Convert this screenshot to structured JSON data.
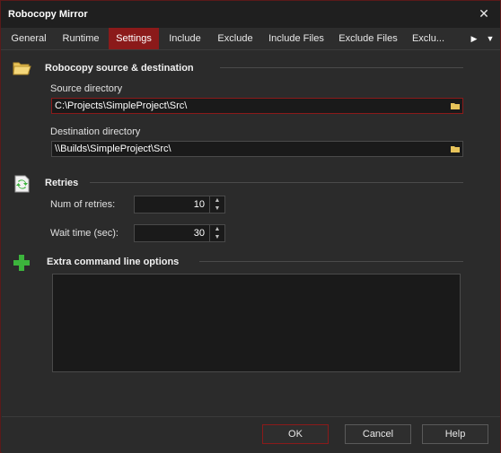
{
  "window": {
    "title": "Robocopy Mirror",
    "close_glyph": "✕"
  },
  "tabs": [
    {
      "label": "General"
    },
    {
      "label": "Runtime"
    },
    {
      "label": "Settings"
    },
    {
      "label": "Include"
    },
    {
      "label": "Exclude"
    },
    {
      "label": "Include Files"
    },
    {
      "label": "Exclude Files"
    },
    {
      "label": "Exclu..."
    }
  ],
  "tab_scroll": {
    "right_glyph": "▶",
    "menu_glyph": "▼"
  },
  "source_section": {
    "title": "Robocopy source & destination",
    "icon": "folder-icon",
    "source_label": "Source directory",
    "source_value": "C:\\Projects\\SimpleProject\\Src\\",
    "dest_label": "Destination directory",
    "dest_value": "\\\\Builds\\SimpleProject\\Src\\"
  },
  "retries_section": {
    "title": "Retries",
    "icon": "retry-document-icon",
    "num_label": "Num of retries:",
    "num_value": "10",
    "wait_label": "Wait time (sec):",
    "wait_value": "30"
  },
  "extra_section": {
    "title": "Extra command line options",
    "icon": "plus-icon",
    "value": ""
  },
  "buttons": {
    "ok": "OK",
    "cancel": "Cancel",
    "help": "Help"
  },
  "colors": {
    "accent": "#8b1a1a",
    "background": "#2b2b2b",
    "plus_green": "#3cb43c"
  }
}
